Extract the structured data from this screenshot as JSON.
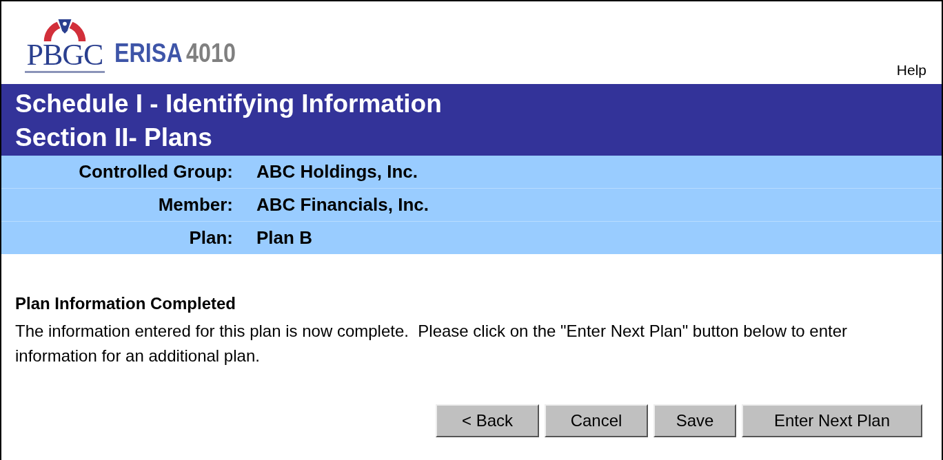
{
  "logo": {
    "mark": "PBGC",
    "product": "ERISA",
    "number": "4010"
  },
  "help_link": "Help",
  "title": {
    "line_1": "Schedule I - Identifying Information",
    "line_2": "Section II- Plans"
  },
  "info_rows": [
    {
      "label": "Controlled Group:",
      "value": "ABC Holdings, Inc."
    },
    {
      "label": "Member:",
      "value": "ABC Financials, Inc."
    },
    {
      "label": "Plan:",
      "value": "Plan B"
    }
  ],
  "message": {
    "heading": "Plan Information Completed",
    "body": "The information entered for this plan is now complete.  Please click on the \"Enter Next Plan\" button below to enter information for an additional plan."
  },
  "buttons": [
    "< Back",
    "Cancel",
    "Save",
    "Enter Next Plan"
  ]
}
